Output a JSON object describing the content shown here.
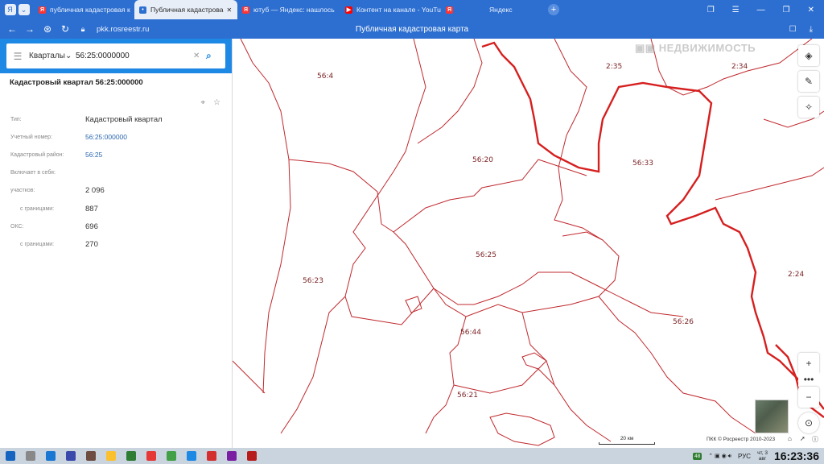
{
  "browser": {
    "tabs": [
      {
        "icon": "yandex",
        "title": "публичная кадастровая к",
        "active": false
      },
      {
        "icon": "pkk",
        "title": "Публичная кадастрова",
        "active": true
      },
      {
        "icon": "yandex",
        "title": "ютуб — Яндекс: нашлось",
        "active": false
      },
      {
        "icon": "youtube",
        "title": "Контент на канале - YouTu",
        "active": false
      },
      {
        "icon": "yandex",
        "title": "Яндекс",
        "active": false
      }
    ],
    "url": "pkk.rosreestr.ru",
    "page_title": "Публичная кадастровая карта"
  },
  "panel": {
    "search": {
      "layer": "Кварталы",
      "query": "56:25:0000000"
    },
    "card_title": "Кадастровый квартал 56:25:000000",
    "fields": [
      {
        "key": "Тип:",
        "value": "Кадастровый квартал",
        "link": false,
        "sub": false
      },
      {
        "key": "Учетный номер:",
        "value": "56:25:000000",
        "link": true,
        "sub": false
      },
      {
        "key": "Кадастровый район:",
        "value": "56:25",
        "link": true,
        "sub": false
      },
      {
        "key": "Включает в себя:",
        "value": "",
        "link": false,
        "sub": false
      },
      {
        "key": "участков:",
        "value": "2 096",
        "link": false,
        "sub": false
      },
      {
        "key": "с границами:",
        "value": "887",
        "link": false,
        "sub": true
      },
      {
        "key": "ОКС:",
        "value": "696",
        "link": false,
        "sub": false
      },
      {
        "key": "с границами:",
        "value": "270",
        "link": false,
        "sub": true
      }
    ]
  },
  "map": {
    "watermark": "НЕДВИЖИМОСТЬ",
    "labels": [
      "56:4",
      "2:35",
      "2:34",
      "56:20",
      "56:33",
      "56:25",
      "56:23",
      "2:24",
      "56:44",
      "56:26",
      "56:21"
    ],
    "scale": "20 км",
    "copyright": "ПКК © Росреестр 2010-2023",
    "boundary_color": "#c0282d",
    "highlight_color": "#d61f1f"
  },
  "taskbar": {
    "badge": "48",
    "lang": "РУС",
    "date_day": "чт, 3",
    "date_month": "авг",
    "time": "16:23:36"
  }
}
